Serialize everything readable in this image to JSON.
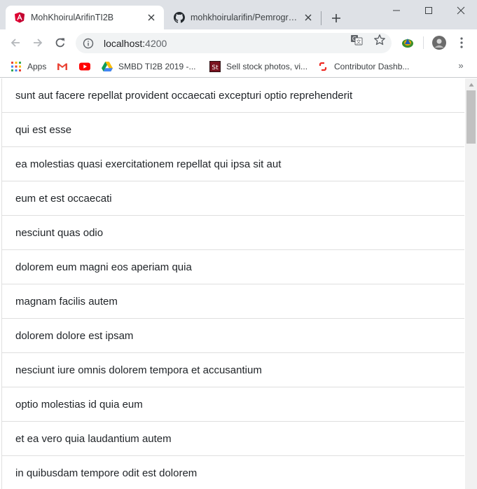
{
  "tabs": [
    {
      "title": "MohKhoirulArifinTI2B",
      "favicon": "angular-icon",
      "active": true
    },
    {
      "title": "mohkhoirularifin/Pemrograman",
      "favicon": "github-icon",
      "active": false
    }
  ],
  "toolbar": {
    "url_host": "localhost:",
    "url_port": "4200"
  },
  "bookmarks": {
    "apps_label": "Apps",
    "items": [
      {
        "label": "SMBD TI2B 2019 -...",
        "icon": "google-drive-icon"
      },
      {
        "label": "Sell stock photos, vi...",
        "icon": "shutterstock-icon"
      },
      {
        "label": "Contributor Dashb...",
        "icon": "contributor-dashboard-icon"
      }
    ],
    "more_label": "»"
  },
  "list": {
    "items": [
      "sunt aut facere repellat provident occaecati excepturi optio reprehenderit",
      "qui est esse",
      "ea molestias quasi exercitationem repellat qui ipsa sit aut",
      "eum et est occaecati",
      "nesciunt quas odio",
      "dolorem eum magni eos aperiam quia",
      "magnam facilis autem",
      "dolorem dolore est ipsam",
      "nesciunt iure omnis dolorem tempora et accusantium",
      "optio molestias id quia eum",
      "et ea vero quia laudantium autem",
      "in quibusdam tempore odit est dolorem"
    ]
  },
  "colors": {
    "tabstrip": "#dee1e6",
    "angular_red": "#dd0031",
    "gmail_red": "#ea4335",
    "youtube_red": "#ff0000",
    "shutterstock_red": "#ee2b24",
    "list_border": "#dfdfdf",
    "text": "#212529"
  }
}
